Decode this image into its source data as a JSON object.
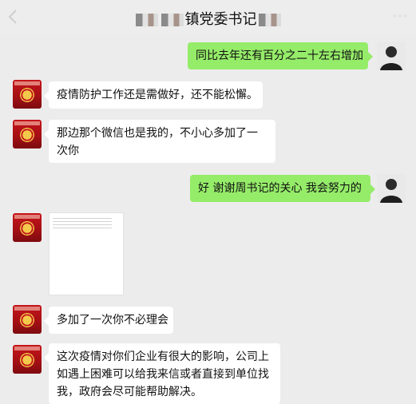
{
  "header": {
    "title": "镇党委书记",
    "back_icon": "chevron-left-icon",
    "more_icon": "more-dots-icon"
  },
  "messages": [
    {
      "side": "right",
      "text": "同比去年还有百分之二十左右增加"
    },
    {
      "side": "left",
      "text": "疫情防护工作还是需做好，还不能松懈。"
    },
    {
      "side": "left",
      "text": "那边那个微信也是我的，不小心多加了一次你"
    },
    {
      "side": "right",
      "text": "好 谢谢周书记的关心 我会努力的"
    },
    {
      "side": "left",
      "type": "image"
    },
    {
      "side": "left",
      "text": "多加了一次你不必理会"
    },
    {
      "side": "left",
      "text": "这次疫情对你们企业有很大的影响，公司上如遇上困难可以给我来信或者直接到单位找我，政府会尽可能帮助解决。"
    }
  ],
  "colors": {
    "background": "#ececec",
    "bubble_self": "#95ec69",
    "bubble_other": "#ffffff"
  }
}
